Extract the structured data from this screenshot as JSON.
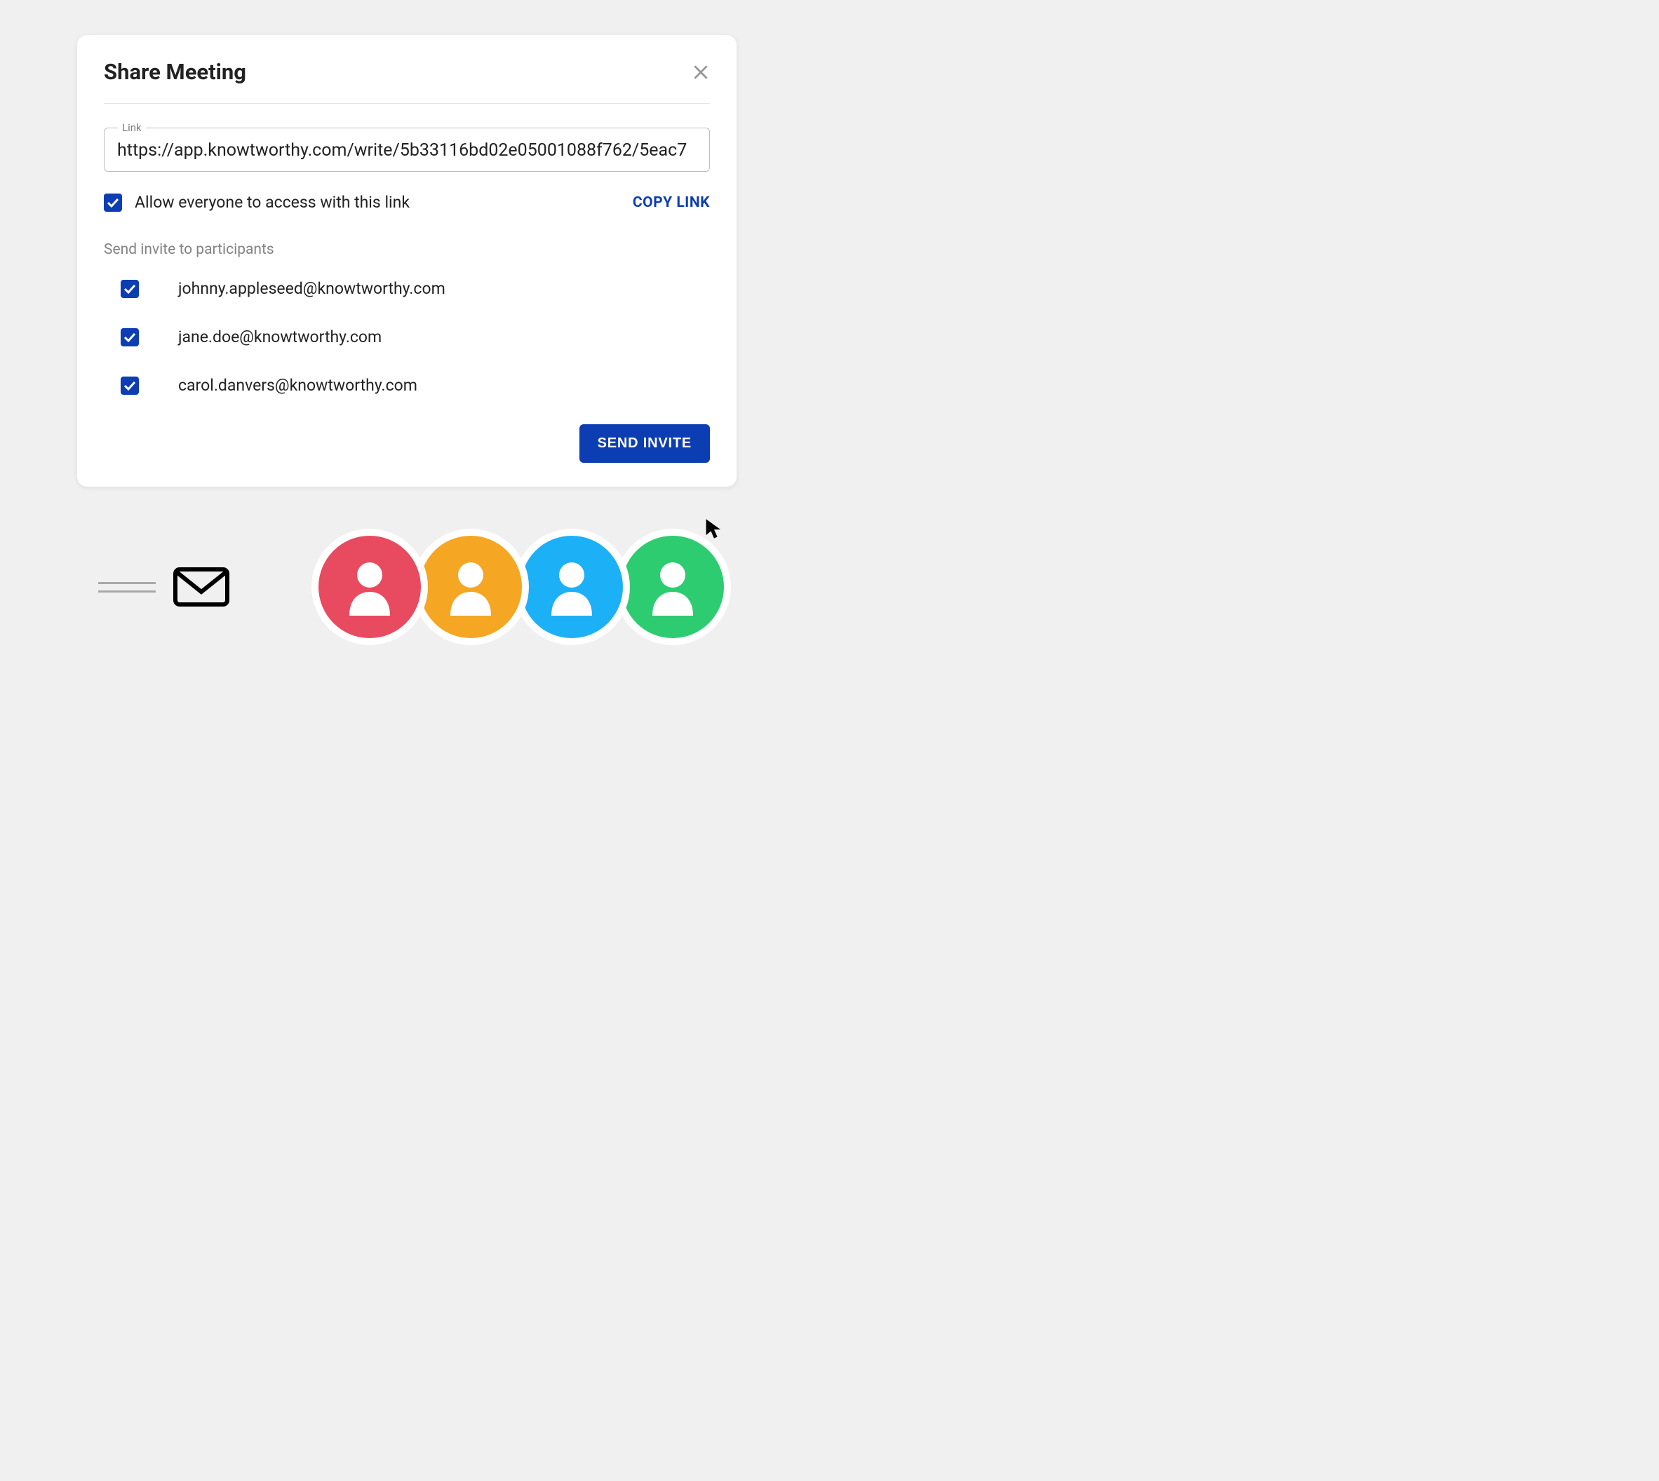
{
  "dialog": {
    "title": "Share Meeting",
    "link_label": "Link",
    "link_value": "https://app.knowtworthy.com/write/5b33116bd02e05001088f762/5eac7",
    "allow_label": "Allow everyone to access with this link",
    "copy_link": "COPY LINK",
    "send_invite_label": "Send invite to participants",
    "participants": [
      "johnny.appleseed@knowtworthy.com",
      "jane.doe@knowtworthy.com",
      "carol.danvers@knowtworthy.com"
    ],
    "send_button": "SEND INVITE"
  },
  "colors": {
    "primary": "#0d3db3",
    "avatar_1": "#e84a5f",
    "avatar_2": "#f5a623",
    "avatar_3": "#1cb0f6",
    "avatar_4": "#2ecc71"
  },
  "icons": {
    "close": "close-icon",
    "mail": "mail-icon",
    "person": "person-icon"
  }
}
